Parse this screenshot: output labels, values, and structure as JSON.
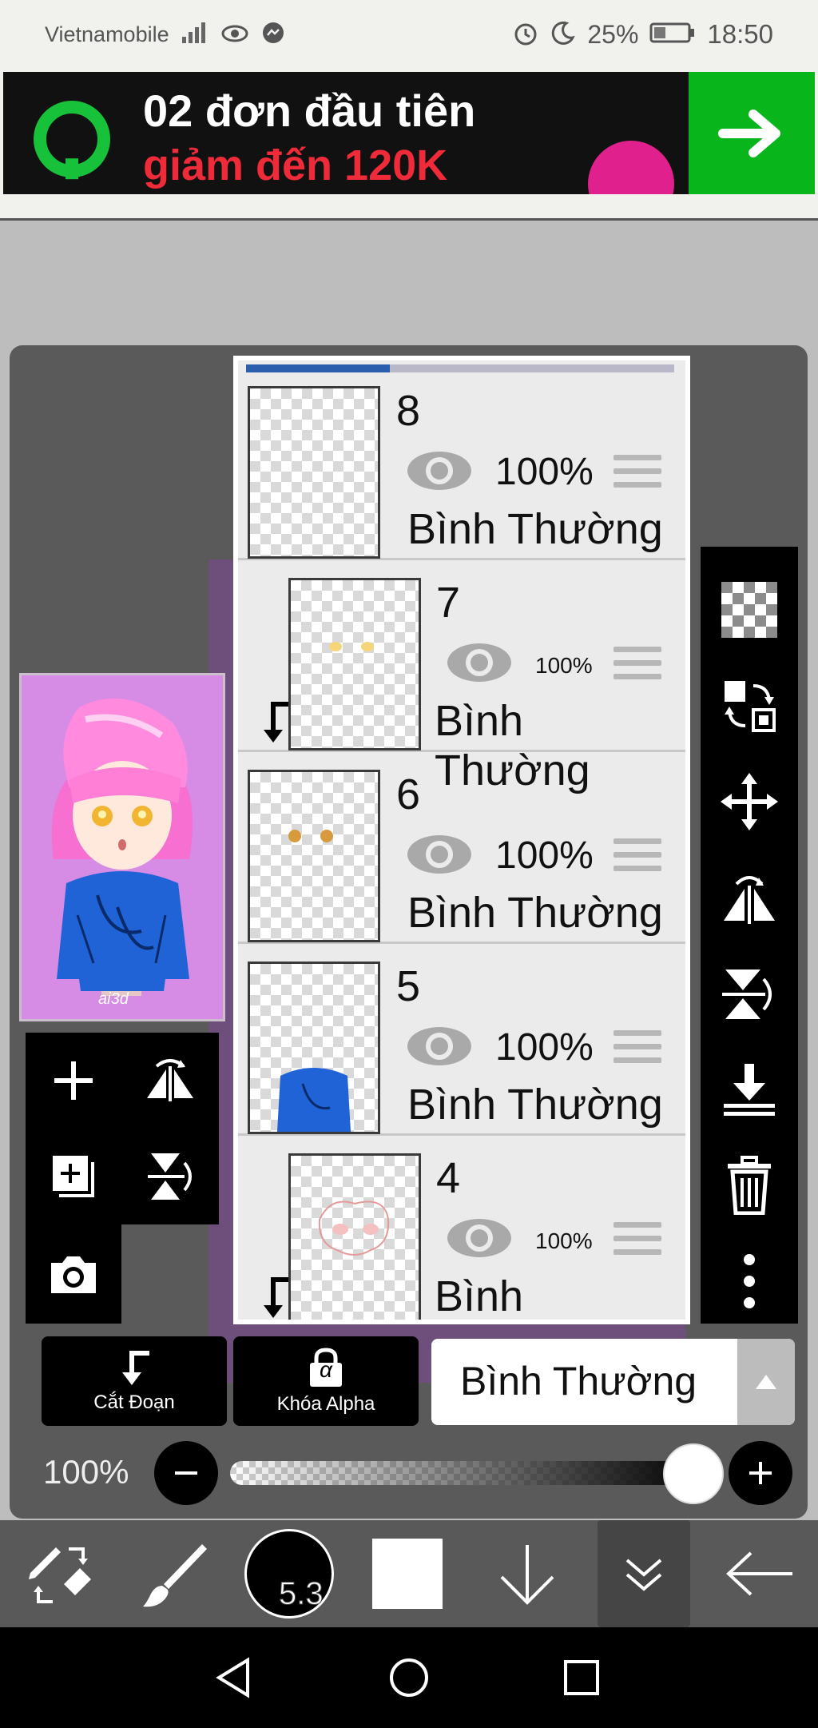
{
  "status_bar": {
    "carrier": "Vietnamobile",
    "battery": "25%",
    "time": "18:50"
  },
  "ad": {
    "line1": "02 đơn đầu tiên",
    "line2": "giảm đến 120K",
    "colors": {
      "logo": "#17c13a",
      "cta": "#08b51b",
      "accent": "#ef2b3a"
    }
  },
  "thumbnail": {
    "signature": "ai3d"
  },
  "layers": [
    {
      "number": "8",
      "opacity": "100%",
      "blend": "Bình Thường",
      "clipped": false,
      "visible": true
    },
    {
      "number": "7",
      "opacity": "100%",
      "blend": "Bình Thường",
      "clipped": true,
      "visible": true
    },
    {
      "number": "6",
      "opacity": "100%",
      "blend": "Bình Thường",
      "clipped": false,
      "visible": true
    },
    {
      "number": "5",
      "opacity": "100%",
      "blend": "Bình Thường",
      "clipped": false,
      "visible": true
    },
    {
      "number": "4",
      "opacity": "100%",
      "blend": "Bình Thường",
      "clipped": true,
      "visible": true
    }
  ],
  "right_tools": [
    "checker-icon",
    "swap-layers-icon",
    "move-icon",
    "flip-horizontal-icon",
    "flip-vertical-icon",
    "merge-down-icon",
    "trash-icon",
    "more-icon"
  ],
  "left_tools": [
    "add-layer-icon",
    "flip-layer-icon",
    "duplicate-layer-icon",
    "flip-vertical-layer-icon",
    "camera-icon"
  ],
  "controls": {
    "clipping_label": "Cắt Đoạn",
    "alpha_lock_label": "Khóa Alpha",
    "alpha_symbol": "α",
    "blend_mode": "Bình Thường",
    "opacity_label": "100%",
    "opacity_value": 1.0
  },
  "toolbar": {
    "brush_size": "5.3",
    "primary_color": "#000000",
    "secondary_color": "#ffffff"
  }
}
